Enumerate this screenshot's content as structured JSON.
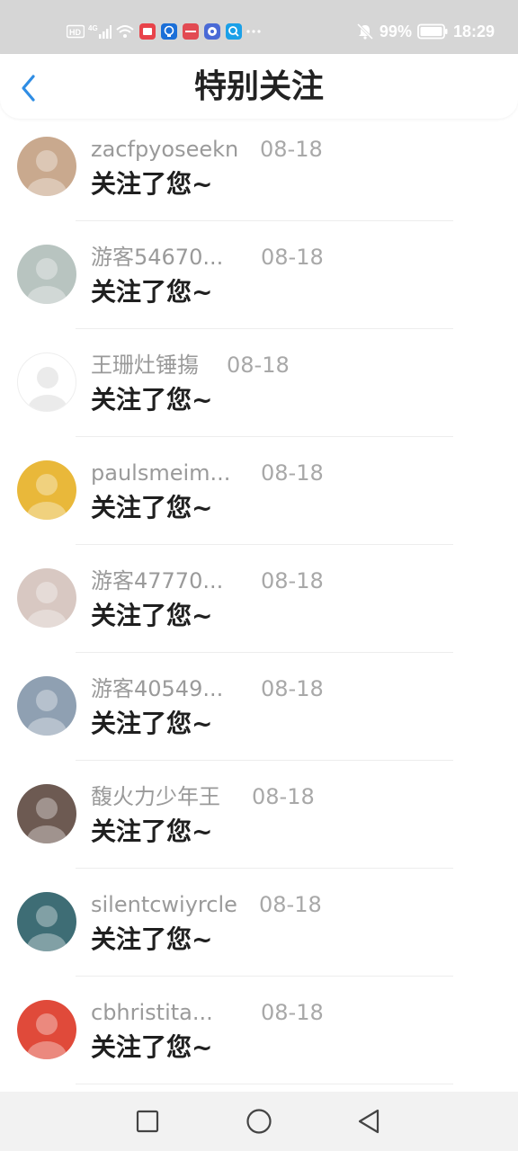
{
  "status_bar": {
    "left_icons": [
      "hd-icon",
      "4g-signal-icon",
      "wifi-icon",
      "app-notification-red-icon",
      "app-notification-blue-icon",
      "app-notification-red2-icon",
      "app-notification-music-icon",
      "app-notification-search-icon",
      "more-dots-icon"
    ],
    "battery_text": "99%",
    "time": "18:29"
  },
  "header": {
    "title": "特别关注"
  },
  "list": {
    "items": [
      {
        "name": "zacfpyoseekn",
        "date": "08-18",
        "message": "关注了您~",
        "avatar_color": "#c9a98e"
      },
      {
        "name": "游客54670...",
        "date": "08-18",
        "message": "关注了您~",
        "avatar_color": "#b8c4c0"
      },
      {
        "name": "王珊灶锤摥",
        "date": "08-18",
        "message": "关注了您~",
        "avatar_color": "#ffffff"
      },
      {
        "name": "paulsmeim...",
        "date": "08-18",
        "message": "关注了您~",
        "avatar_color": "#e9b83a"
      },
      {
        "name": "游客47770...",
        "date": "08-18",
        "message": "关注了您~",
        "avatar_color": "#d8c8c2"
      },
      {
        "name": "游客40549...",
        "date": "08-18",
        "message": "关注了您~",
        "avatar_color": "#8fa0b2"
      },
      {
        "name": "馥火力少年王",
        "date": "08-18",
        "message": "关注了您~",
        "avatar_color": "#6d5a52"
      },
      {
        "name": "silentcwiyrcle",
        "date": "08-18",
        "message": "关注了您~",
        "avatar_color": "#3e6d75"
      },
      {
        "name": "cbhristita...",
        "date": "08-18",
        "message": "关注了您~",
        "avatar_color": "#e04a3a"
      }
    ]
  },
  "nav_bar": {
    "buttons": [
      "recents-square-icon",
      "home-circle-icon",
      "back-triangle-icon"
    ]
  }
}
